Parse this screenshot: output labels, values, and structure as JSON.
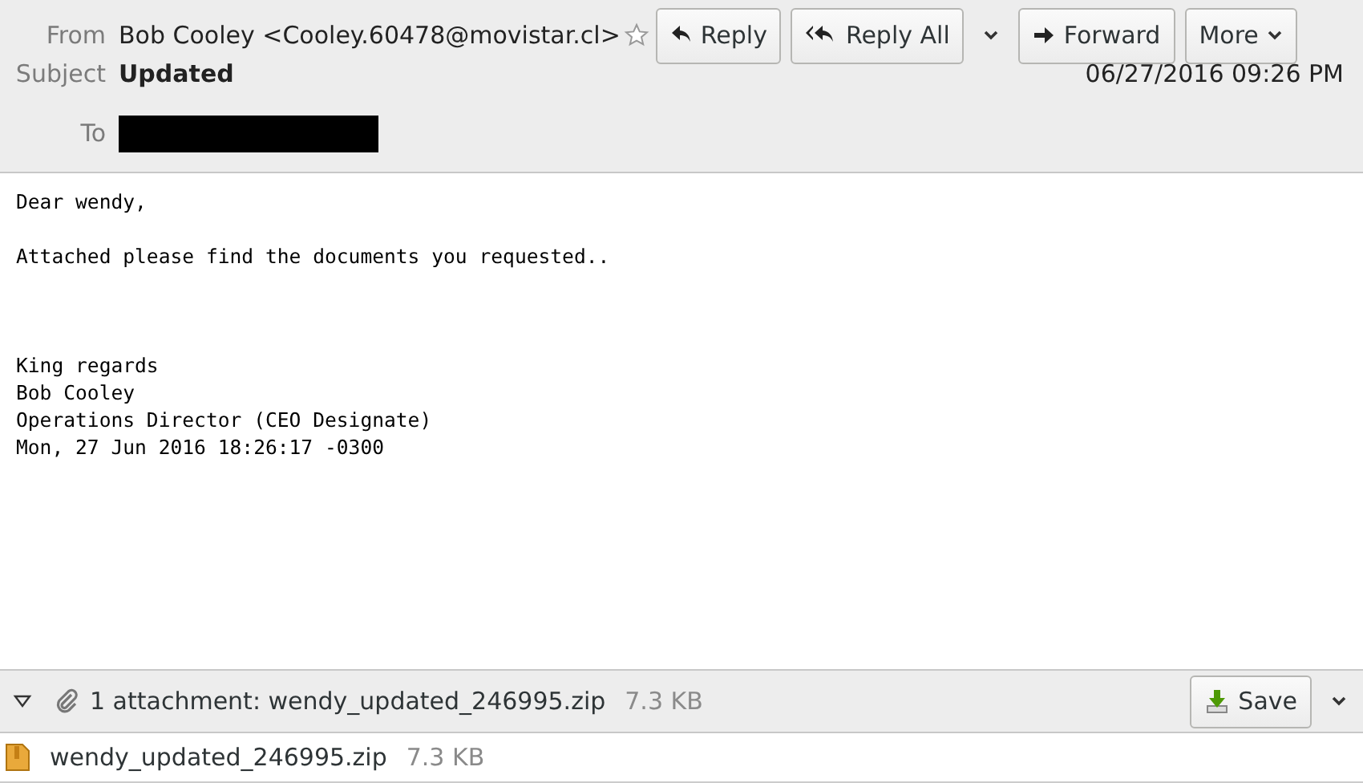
{
  "header": {
    "from_label": "From",
    "from": "Bob Cooley <Cooley.60478@movistar.cl>",
    "starred": false,
    "subject_label": "Subject",
    "subject": "Updated",
    "to_label": "To",
    "date": "06/27/2016 09:26 PM"
  },
  "buttons": [
    {
      "kind": "reply",
      "label": "Reply"
    },
    {
      "kind": "reply_all",
      "label": "Reply All"
    },
    {
      "kind": "dropdown"
    },
    {
      "kind": "forward",
      "label": "Forward"
    },
    {
      "kind": "more",
      "label": "More"
    }
  ],
  "body": [
    {
      "lines": [
        "Dear wendy,"
      ]
    },
    {
      "lines": [
        "Attached please find the documents you requested.."
      ]
    },
    {
      "lines": [
        "King regards",
        "Bob Cooley",
        "Operations Director (CEO Designate)",
        "Mon, 27 Jun 2016 18:26:17 -0300"
      ]
    }
  ],
  "attachment_bar": {
    "expanded": true,
    "summary": "1 attachment: wendy_updated_246995.zip",
    "size": "7.3 KB",
    "save_label": "Save"
  },
  "attachments": [
    {
      "name": "wendy_updated_246995.zip",
      "size": "7.3 KB"
    }
  ]
}
